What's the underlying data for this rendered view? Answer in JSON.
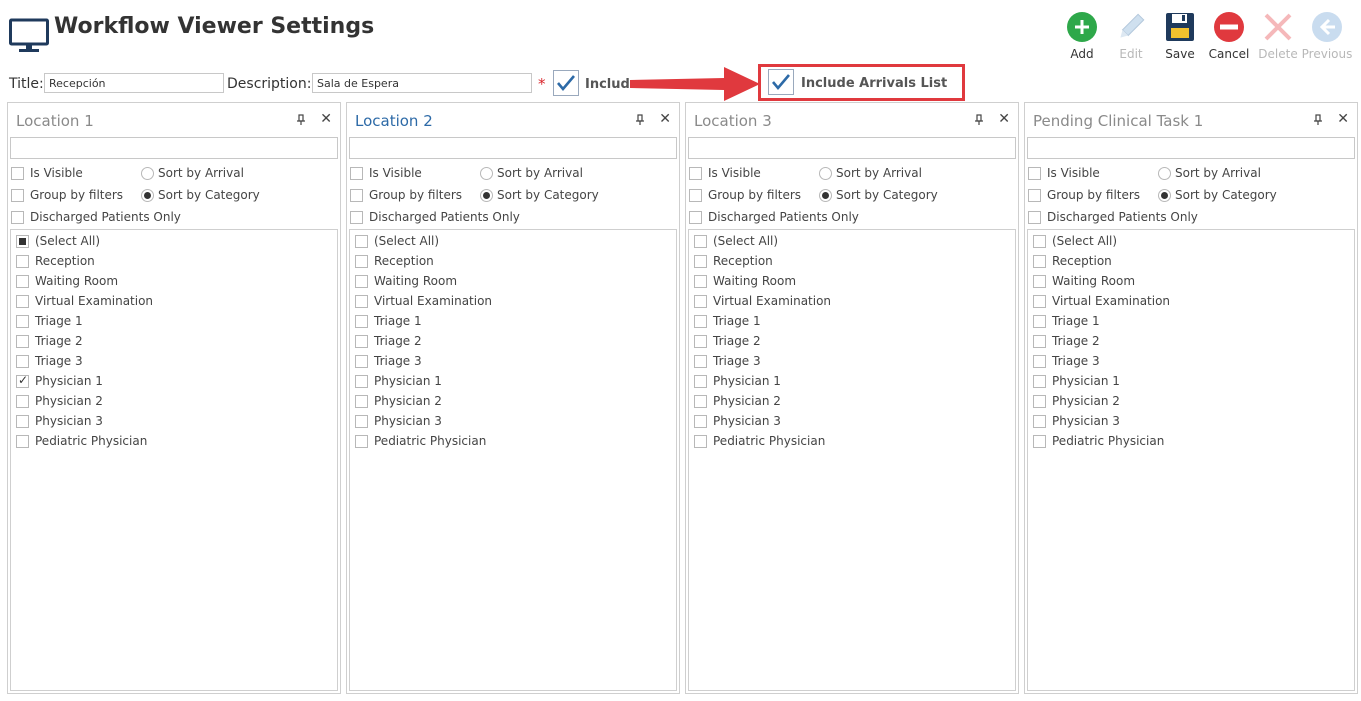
{
  "app": {
    "title": "Workflow Viewer Settings"
  },
  "toolbar": [
    {
      "label": "Add",
      "icon": "add-icon",
      "enabled": true
    },
    {
      "label": "Edit",
      "icon": "edit-icon",
      "enabled": false
    },
    {
      "label": "Save",
      "icon": "save-icon",
      "enabled": true
    },
    {
      "label": "Cancel",
      "icon": "cancel-icon",
      "enabled": true
    },
    {
      "label": "Delete",
      "icon": "delete-icon",
      "enabled": false
    },
    {
      "label": "Previous",
      "icon": "previous-icon",
      "enabled": false
    }
  ],
  "form": {
    "title_label": "Title:",
    "title_value": "Recepción",
    "description_label": "Description:",
    "description_value": "Sala de Espera",
    "required_mark": "*",
    "include_label": "Include",
    "include_checked": true,
    "include_arrivals_label": "Include Arrivals List",
    "include_arrivals_checked": true
  },
  "panels": [
    {
      "title": "Location 1",
      "active": false,
      "is_visible_label": "Is Visible",
      "is_visible": false,
      "group_label": "Group by filters",
      "group": false,
      "discharged_label": "Discharged Patients Only",
      "discharged": false,
      "sort_arrival_label": "Sort by Arrival",
      "sort_category_label": "Sort by Category",
      "sort": "category",
      "items": [
        {
          "label": "(Select All)",
          "state": "partial"
        },
        {
          "label": "Reception",
          "state": "off"
        },
        {
          "label": "Waiting Room",
          "state": "off"
        },
        {
          "label": "Virtual Examination",
          "state": "off"
        },
        {
          "label": "Triage 1",
          "state": "off"
        },
        {
          "label": "Triage 2",
          "state": "off"
        },
        {
          "label": "Triage 3",
          "state": "off"
        },
        {
          "label": "Physician 1",
          "state": "on"
        },
        {
          "label": "Physician 2",
          "state": "off"
        },
        {
          "label": "Physician 3",
          "state": "off"
        },
        {
          "label": "Pediatric Physician",
          "state": "off"
        }
      ]
    },
    {
      "title": "Location 2",
      "active": true,
      "is_visible_label": "Is Visible",
      "is_visible": false,
      "group_label": "Group by filters",
      "group": false,
      "discharged_label": "Discharged Patients Only",
      "discharged": false,
      "sort_arrival_label": "Sort by Arrival",
      "sort_category_label": "Sort by Category",
      "sort": "category",
      "items": [
        {
          "label": "(Select All)",
          "state": "off"
        },
        {
          "label": "Reception",
          "state": "off"
        },
        {
          "label": "Waiting Room",
          "state": "off"
        },
        {
          "label": "Virtual Examination",
          "state": "off"
        },
        {
          "label": "Triage 1",
          "state": "off"
        },
        {
          "label": "Triage 2",
          "state": "off"
        },
        {
          "label": "Triage 3",
          "state": "off"
        },
        {
          "label": "Physician 1",
          "state": "off"
        },
        {
          "label": "Physician 2",
          "state": "off"
        },
        {
          "label": "Physician 3",
          "state": "off"
        },
        {
          "label": "Pediatric Physician",
          "state": "off"
        }
      ]
    },
    {
      "title": "Location 3",
      "active": false,
      "is_visible_label": "Is Visible",
      "is_visible": false,
      "group_label": "Group by filters",
      "group": false,
      "discharged_label": "Discharged Patients Only",
      "discharged": false,
      "sort_arrival_label": "Sort by Arrival",
      "sort_category_label": "Sort by Category",
      "sort": "category",
      "items": [
        {
          "label": "(Select All)",
          "state": "off"
        },
        {
          "label": "Reception",
          "state": "off"
        },
        {
          "label": "Waiting Room",
          "state": "off"
        },
        {
          "label": "Virtual Examination",
          "state": "off"
        },
        {
          "label": "Triage 1",
          "state": "off"
        },
        {
          "label": "Triage 2",
          "state": "off"
        },
        {
          "label": "Triage 3",
          "state": "off"
        },
        {
          "label": "Physician 1",
          "state": "off"
        },
        {
          "label": "Physician 2",
          "state": "off"
        },
        {
          "label": "Physician 3",
          "state": "off"
        },
        {
          "label": "Pediatric Physician",
          "state": "off"
        }
      ]
    },
    {
      "title": "Pending Clinical Task 1",
      "active": false,
      "is_visible_label": "Is Visible",
      "is_visible": false,
      "group_label": "Group by filters",
      "group": false,
      "discharged_label": "Discharged Patients Only",
      "discharged": false,
      "sort_arrival_label": "Sort by Arrival",
      "sort_category_label": "Sort by Category",
      "sort": "category",
      "items": [
        {
          "label": "(Select All)",
          "state": "off"
        },
        {
          "label": "Reception",
          "state": "off"
        },
        {
          "label": "Waiting Room",
          "state": "off"
        },
        {
          "label": "Virtual Examination",
          "state": "off"
        },
        {
          "label": "Triage 1",
          "state": "off"
        },
        {
          "label": "Triage 2",
          "state": "off"
        },
        {
          "label": "Triage 3",
          "state": "off"
        },
        {
          "label": "Physician 1",
          "state": "off"
        },
        {
          "label": "Physician 2",
          "state": "off"
        },
        {
          "label": "Physician 3",
          "state": "off"
        },
        {
          "label": "Pediatric Physician",
          "state": "off"
        }
      ]
    }
  ],
  "colors": {
    "accent": "#2d6aa7",
    "add": "#2ea84a",
    "cancel": "#e0393e",
    "highlight": "#e0393e",
    "disabled": "#b8b8b8"
  }
}
